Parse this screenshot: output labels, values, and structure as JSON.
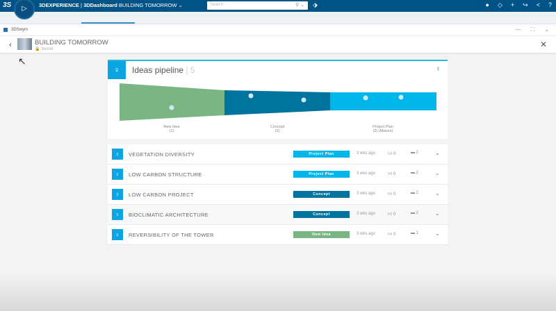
{
  "topbar": {
    "brand": "3DEXPERIENCE",
    "separator": " | ",
    "app": "3DDashboard",
    "dashboard": "BUILDING TOMORROW",
    "search_placeholder": "Search"
  },
  "widget": {
    "name": "3DSwym"
  },
  "community": {
    "title": "BUILDING TOMORROW",
    "visibility": "Secret"
  },
  "pipeline": {
    "title": "Ideas pipeline",
    "count": "5",
    "chart_data": {
      "type": "funnel",
      "stages": [
        {
          "label": "New Idea",
          "count_label": "(1)",
          "count": 1,
          "color": "#7ab584"
        },
        {
          "label": "Concept",
          "count_label": "(2)",
          "count": 2,
          "color": "#00739e"
        },
        {
          "label": "Project Plan",
          "count_label": "(2) (Mature)",
          "count": 2,
          "color": "#00b5ea"
        }
      ]
    }
  },
  "ideas": [
    {
      "name": "VEGETATION DIVERSITY",
      "status": "Project Plan",
      "status_color": "#00b5ea",
      "time": "3 wks ago",
      "likes": "0",
      "comments": "2"
    },
    {
      "name": "LOW CARBON STRUCTURE",
      "status": "Project Plan",
      "status_color": "#00b5ea",
      "time": "3 wks ago",
      "likes": "0",
      "comments": "2"
    },
    {
      "name": "LOW CARBON PROJECT",
      "status": "Concept",
      "status_color": "#00739e",
      "time": "3 wks ago",
      "likes": "0",
      "comments": "2"
    },
    {
      "name": "BIOCLIMATIC ARCHITECTURE",
      "status": "Concept",
      "status_color": "#00739e",
      "time": "3 wks ago",
      "likes": "0",
      "comments": "2"
    },
    {
      "name": "REVERSIBILITY OF THE TOWER",
      "status": "New Idea",
      "status_color": "#7ab584",
      "time": "3 wks ago",
      "likes": "0",
      "comments": "1"
    }
  ]
}
